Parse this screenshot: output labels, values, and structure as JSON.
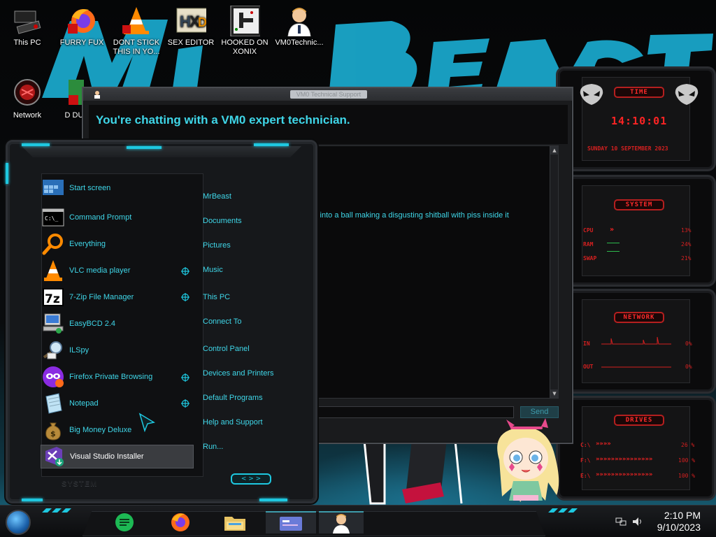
{
  "desktop": {
    "icons": [
      {
        "label": "This PC",
        "icon": "computer-icon"
      },
      {
        "label": "FURRY FUX",
        "icon": "firefox-icon"
      },
      {
        "label": "DONT STICK THIS IN YO...",
        "icon": "vlc-cone-icon"
      },
      {
        "label": "SEX EDITOR",
        "icon": "hex-editor-icon"
      },
      {
        "label": "HOOKED ON XONIX",
        "icon": "xonix-game-icon"
      },
      {
        "label": "VM0Technic...",
        "icon": "technician-icon"
      },
      {
        "label": "Network",
        "icon": "network-icon"
      },
      {
        "label": "D DU",
        "icon": "document-icon"
      }
    ]
  },
  "chat_window": {
    "title": "VM0 Technical Support",
    "heading": "You're chatting with a VM0 expert technician.",
    "message": "it into a ball making a disgusting shitball with piss inside it",
    "input_value": "",
    "send_label": "Send"
  },
  "start_menu": {
    "programs": [
      {
        "label": "Start screen",
        "icon": "start-screen-icon",
        "has_submenu": false
      },
      {
        "label": "Command Prompt",
        "icon": "command-prompt-icon",
        "has_submenu": false
      },
      {
        "label": "Everything",
        "icon": "magnifier-icon",
        "has_submenu": false
      },
      {
        "label": "VLC media player",
        "icon": "vlc-cone-icon",
        "has_submenu": true
      },
      {
        "label": "7-Zip File Manager",
        "icon": "7zip-icon",
        "has_submenu": true
      },
      {
        "label": "EasyBCD 2.4",
        "icon": "easybcd-icon",
        "has_submenu": false
      },
      {
        "label": "ILSpy",
        "icon": "ilspy-icon",
        "has_submenu": false
      },
      {
        "label": "Firefox Private Browsing",
        "icon": "firefox-private-icon",
        "has_submenu": true
      },
      {
        "label": "Notepad",
        "icon": "notepad-icon",
        "has_submenu": true
      },
      {
        "label": "Big Money Deluxe",
        "icon": "money-bag-icon",
        "has_submenu": false
      },
      {
        "label": "Visual Studio Installer",
        "icon": "visual-studio-installer-icon",
        "has_submenu": false,
        "active": true
      }
    ],
    "links": [
      "MrBeast",
      "Documents",
      "Pictures",
      "Music",
      "This PC",
      "Connect To",
      "Control Panel",
      "Devices and Printers",
      "Default Programs",
      "Help and Support",
      "Run..."
    ],
    "footer_label": "SYSTEM",
    "nav_label": "< > >"
  },
  "gadgets": {
    "time": {
      "title": "TIME",
      "clock": "14:10:01",
      "date": "SUNDAY 10 SEPTEMBER 2023"
    },
    "system": {
      "title": "SYSTEM",
      "rows": [
        {
          "label": "CPU",
          "value": "13%"
        },
        {
          "label": "RAM",
          "value": "24%"
        },
        {
          "label": "SWAP",
          "value": "21%"
        }
      ]
    },
    "network": {
      "title": "NETWORK",
      "rows": [
        {
          "label": "IN",
          "value": "0%"
        },
        {
          "label": "OUT",
          "value": "0%"
        }
      ]
    },
    "drives": {
      "title": "DRIVES",
      "rows": [
        {
          "label": "C:\\",
          "value": "26 %",
          "fill": 0.26
        },
        {
          "label": "F:\\",
          "value": "100 %",
          "fill": 1.0
        },
        {
          "label": "E:\\",
          "value": "100 %",
          "fill": 1.0
        }
      ]
    }
  },
  "taskbar": {
    "pinned": [
      {
        "name": "start-orb-icon"
      },
      {
        "name": "notes-app-icon"
      },
      {
        "name": "firefox-icon"
      },
      {
        "name": "file-explorer-icon"
      },
      {
        "name": "window-card-icon"
      },
      {
        "name": "technician-icon"
      }
    ],
    "time": "2:10 PM",
    "date": "9/10/2023"
  },
  "wallpaper_text": "MrBeast",
  "colors": {
    "accent": "#1ec8e0",
    "link_text": "#3fd6e8",
    "gadget_red": "#ff2424"
  }
}
